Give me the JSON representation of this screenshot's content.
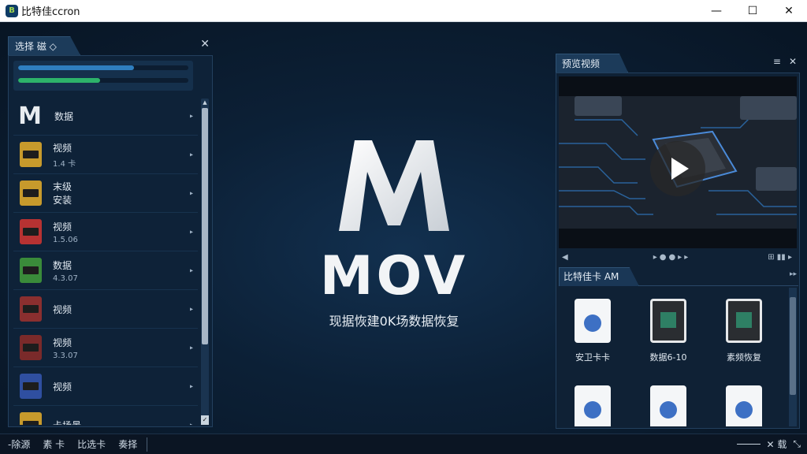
{
  "window": {
    "title": "比特佳ccron",
    "logo_glyph": "B",
    "minimize": "—",
    "maximize": "☐",
    "close": "✕"
  },
  "left_panel": {
    "tab_label": "选择 磁 ◇",
    "close": "✕",
    "progress": [
      {
        "value": 0.68,
        "color": "#2f7fc0"
      },
      {
        "value": 0.48,
        "color": "#2db36a"
      }
    ],
    "items": [
      {
        "label": "数据",
        "sub": "",
        "icon": "m-logo-icon",
        "color": "#e8ecf0"
      },
      {
        "label": "视频",
        "sub": "1.4 卡",
        "icon": "sd-card-icon",
        "color": "#c79a2c"
      },
      {
        "label": "末级\n安装",
        "sub": "",
        "icon": "sd-card-icon",
        "color": "#c79a2c"
      },
      {
        "label": "视频",
        "sub": "1.5.06",
        "icon": "sd-card-icon",
        "color": "#b73232"
      },
      {
        "label": "数据",
        "sub": "4.3.07",
        "icon": "sd-card-icon",
        "color": "#3a8b3a"
      },
      {
        "label": "视频",
        "sub": "",
        "icon": "sd-card-icon",
        "color": "#8a2f2f"
      },
      {
        "label": "视频",
        "sub": "3.3.07",
        "icon": "sd-card-icon",
        "color": "#7a2a2a"
      },
      {
        "label": "视频",
        "sub": "",
        "icon": "sd-card-icon",
        "color": "#2f4fa0"
      },
      {
        "label": "卡场景",
        "sub": "",
        "icon": "sd-card-icon",
        "color": "#c79a2c"
      }
    ],
    "arrow": "▸"
  },
  "center": {
    "brand": "MOV",
    "subtitle": "现据恢建0K场数据恢复"
  },
  "right_panel": {
    "tab_label": "预览视频",
    "ctrl_menu": "≡",
    "ctrl_close": "✕",
    "video_controls": {
      "prev": "◀",
      "dots": "▸●●▸▸",
      "right": "⊞ ▮▮ ▸"
    },
    "sub_tab_label": "比特佳卡 AM",
    "sub_tab_menu": "▸▸",
    "files": [
      {
        "label": "安卫卡卡",
        "type": "doc"
      },
      {
        "label": "数据6-10",
        "type": "video"
      },
      {
        "label": "素频恢复",
        "type": "video"
      },
      {
        "label": "",
        "type": "doc"
      },
      {
        "label": "",
        "type": "doc"
      },
      {
        "label": "",
        "type": "doc"
      }
    ]
  },
  "statusbar": {
    "items": [
      "-除源",
      "素 卡",
      "比选卡",
      "奏择"
    ],
    "right_label": "✕ 载",
    "resize": "⤡"
  }
}
